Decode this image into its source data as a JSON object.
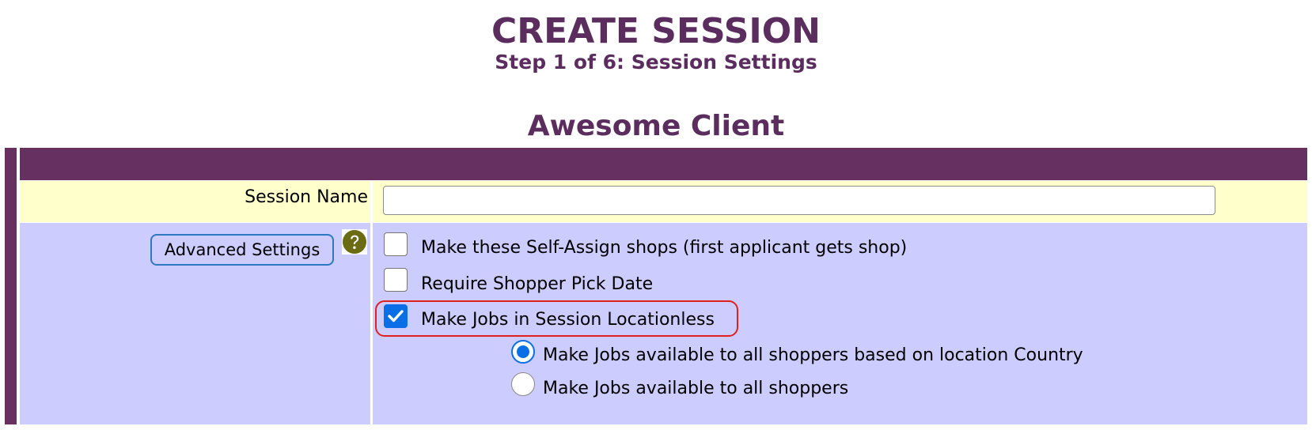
{
  "header": {
    "title": "CREATE SESSION",
    "subtitle": "Step 1 of 6: Session Settings",
    "client_name": "Awesome Client"
  },
  "form": {
    "session_name_label": "Session Name",
    "session_name_value": "",
    "advanced_settings_label": "Advanced Settings",
    "help_icon": "question-circle-icon",
    "options": [
      {
        "label": "Make these Self-Assign shops (first applicant gets shop)",
        "checked": false
      },
      {
        "label": "Require Shopper Pick Date",
        "checked": false
      },
      {
        "label": "Make Jobs in Session Locationless",
        "checked": true,
        "highlighted": true
      }
    ],
    "radio_options": [
      {
        "label": "Make Jobs available to all shoppers based on location Country",
        "selected": true
      },
      {
        "label": "Make Jobs available to all shoppers",
        "selected": false
      }
    ]
  },
  "colors": {
    "brand_purple": "#663061",
    "title_purple": "#5b2d5e",
    "row_yellow": "#ffffcc",
    "row_lavender": "#ccccff",
    "checkbox_blue": "#0a6ee6",
    "highlight_red": "#e02020",
    "help_icon_olive": "#6b6b14"
  }
}
